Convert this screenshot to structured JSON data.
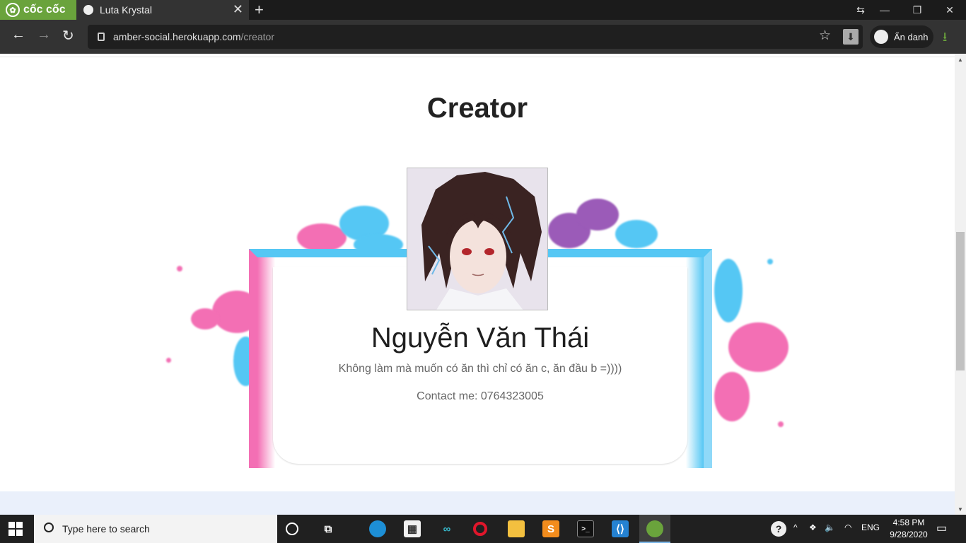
{
  "browser": {
    "brand": "cốc cốc",
    "tab_title": "Luta Krystal",
    "url_host": "amber-social.herokuapp.com",
    "url_path": "/creator",
    "incognito_label": "Ẩn danh"
  },
  "page": {
    "title": "Creator",
    "creator_name": "Nguyễn Văn Thái",
    "quote": "Không làm mà muốn có ăn thì chỉ có ăn c, ăn đầu b =))))",
    "contact": "Contact me: 0764323005"
  },
  "taskbar": {
    "search_placeholder": "Type here to search",
    "language": "ENG",
    "time": "4:58 PM",
    "date": "9/28/2020"
  },
  "colors": {
    "brand_green": "#6aa33c",
    "splash_pink": "#f36fb4",
    "splash_blue": "#55c7f4",
    "splash_purple": "#9b5bb8"
  }
}
